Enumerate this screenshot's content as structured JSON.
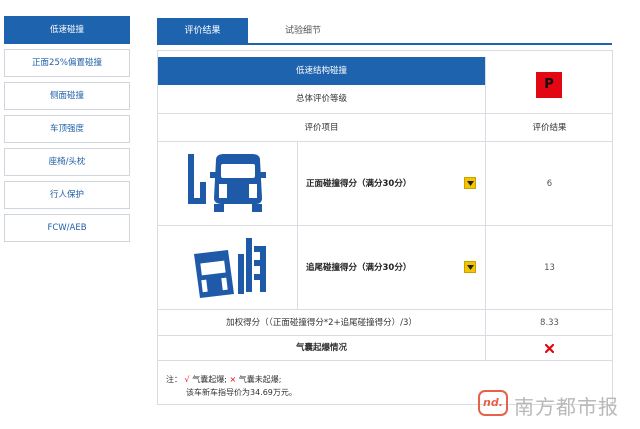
{
  "sidebar": {
    "items": [
      {
        "label": "低速碰撞",
        "active": true
      },
      {
        "label": "正面25%偏置碰撞",
        "active": false
      },
      {
        "label": "侧面碰撞",
        "active": false
      },
      {
        "label": "车顶强度",
        "active": false
      },
      {
        "label": "座椅/头枕",
        "active": false
      },
      {
        "label": "行人保护",
        "active": false
      },
      {
        "label": "FCW/AEB",
        "active": false
      }
    ]
  },
  "tabs": [
    {
      "label": "评价结果",
      "active": true
    },
    {
      "label": "试验细节",
      "active": false
    }
  ],
  "panel": {
    "section_title": "低速结构碰撞",
    "overall_label": "总体评价等级",
    "overall_grade": "P",
    "grade_color": "#e30613",
    "col_item": "评价项目",
    "col_result": "评价结果",
    "rows": [
      {
        "label": "正面碰撞得分（满分30分）",
        "score": "6",
        "icon": "front-crash-icon"
      },
      {
        "label": "追尾碰撞得分（满分30分）",
        "score": "13",
        "icon": "rear-crash-icon"
      }
    ],
    "weighted_label": "加权得分（（正面碰撞得分*2+追尾碰撞得分）/3）",
    "weighted_value": "8.33",
    "airbag_label": "气囊起爆情况",
    "airbag_icon": "cross-icon"
  },
  "note": {
    "prefix": "注：",
    "check": "√",
    "deployed": "气囊起爆;",
    "cross": "×",
    "not_deployed": "气囊未起爆;",
    "price_line": "该车新车指导价为34.69万元。"
  },
  "watermark": {
    "logo": "nd.",
    "text": "南方都市报"
  },
  "colors": {
    "primary": "#1e63ad",
    "accent_yellow": "#f5c400",
    "danger": "#e30613"
  }
}
